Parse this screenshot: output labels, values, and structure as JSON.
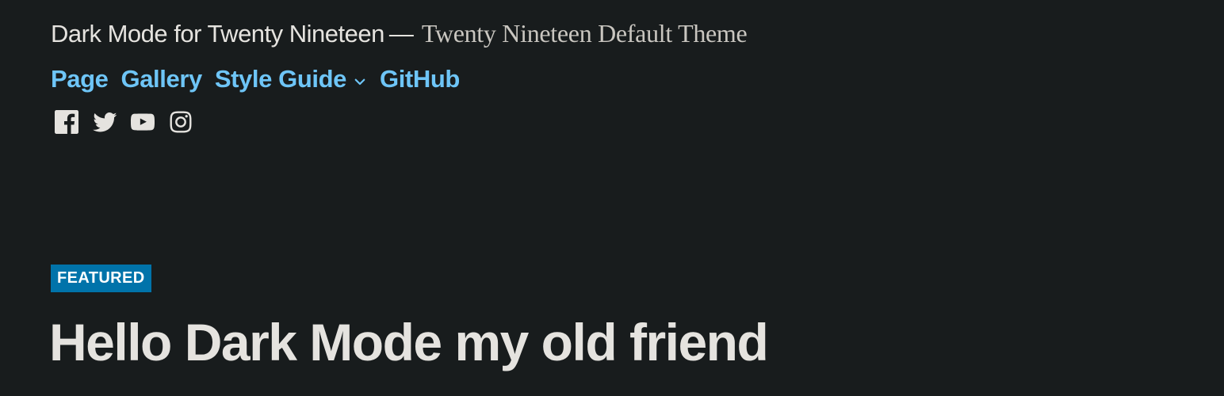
{
  "header": {
    "site_title": "Dark Mode for Twenty Nineteen",
    "separator": "—",
    "tagline": "Twenty Nineteen Default Theme"
  },
  "nav": {
    "items": [
      {
        "label": "Page"
      },
      {
        "label": "Gallery"
      },
      {
        "label": "Style Guide",
        "has_submenu": true,
        "icon": "chevron-down-icon"
      },
      {
        "label": "GitHub"
      }
    ]
  },
  "social": {
    "icons": [
      "facebook-icon",
      "twitter-icon",
      "youtube-icon",
      "instagram-icon"
    ]
  },
  "post": {
    "badge": "FEATURED",
    "title": "Hello Dark Mode my old friend"
  },
  "colors": {
    "background": "#181c1d",
    "text": "#e5e3df",
    "link": "#6ec5f7",
    "badge": "#0073aa"
  }
}
